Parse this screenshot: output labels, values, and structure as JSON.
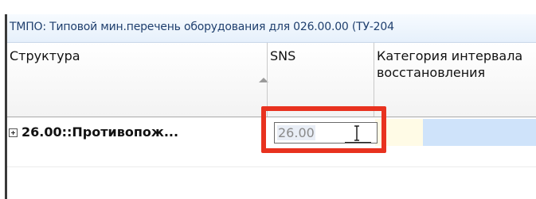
{
  "window": {
    "title": "ТМПО: Типовой мин.перечень оборудования для 026.00.00 (ТУ-204"
  },
  "grid": {
    "columns": [
      {
        "id": "structure",
        "label": "Структура"
      },
      {
        "id": "sns",
        "label": "SNS"
      },
      {
        "id": "category",
        "label": "Категория интервала восстановления"
      }
    ],
    "sort": {
      "column": "structure",
      "direction": "ascending"
    },
    "rows": [
      {
        "expander": "plus",
        "structure": "26.00::Противопож...",
        "sns": "26.00",
        "category": ""
      }
    ]
  },
  "editor": {
    "field": "sns",
    "value": "26.00",
    "cursor": "i-beam"
  },
  "annotation": {
    "highlight_color": "#e8321f",
    "target": "sns-cell-editor"
  },
  "colors": {
    "selection": "#cfe3fa",
    "title_text": "#1f3f6e"
  }
}
